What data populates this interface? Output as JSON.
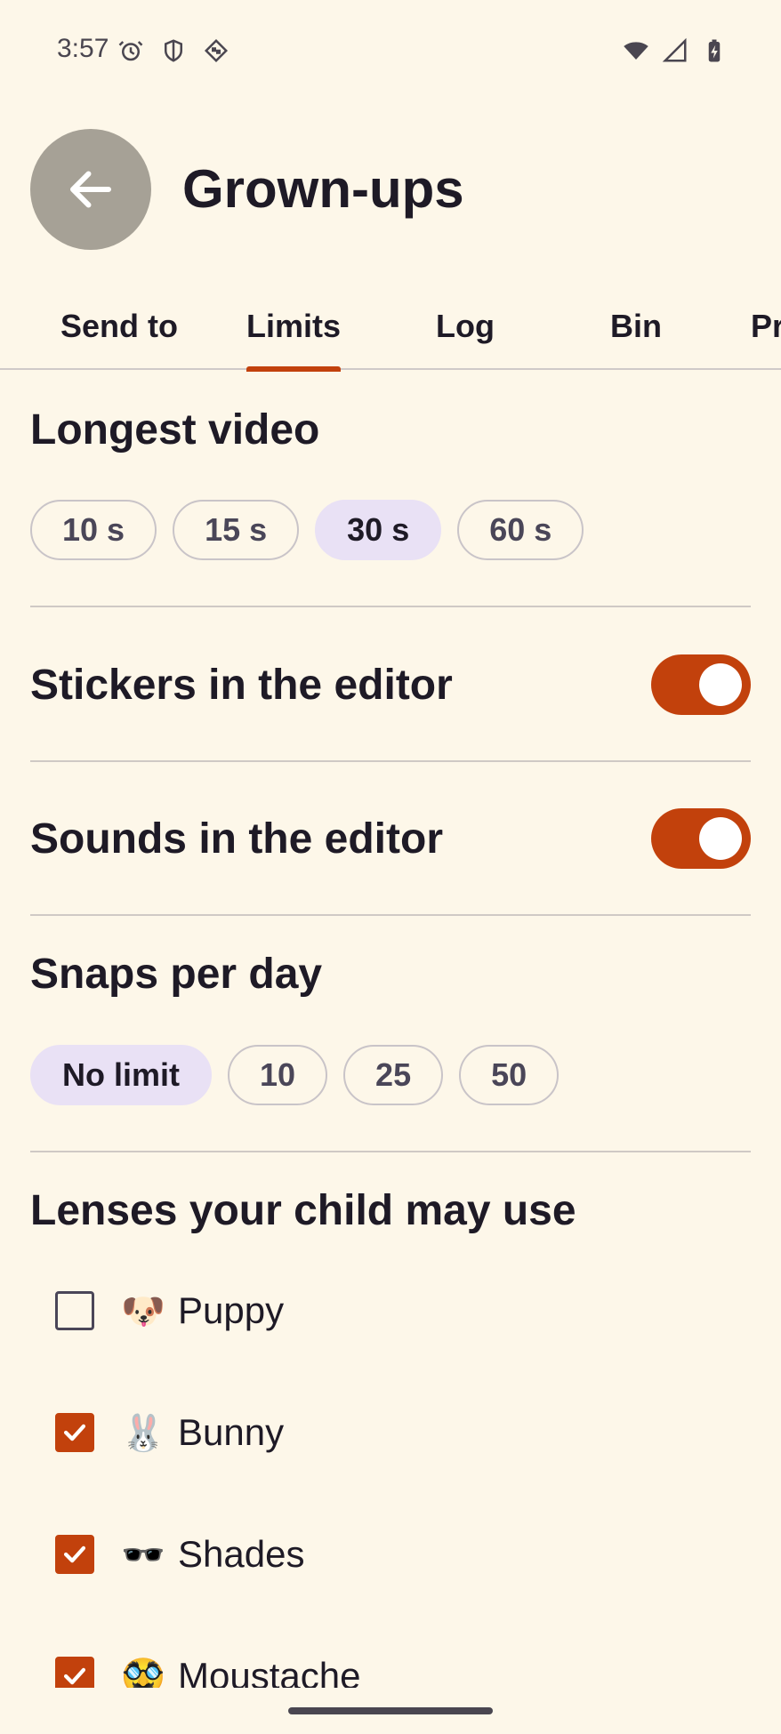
{
  "status_bar": {
    "time": "3:57",
    "left_icons": [
      "alarm-icon",
      "shield-icon",
      "vpn-diamond-icon"
    ],
    "right_icons": [
      "wifi-icon",
      "cell-signal-icon",
      "battery-charging-icon"
    ]
  },
  "header": {
    "back_icon": "arrow-left-icon",
    "title": "Grown-ups"
  },
  "tabs": [
    {
      "label": "Send to",
      "active": false
    },
    {
      "label": "Limits",
      "active": true
    },
    {
      "label": "Log",
      "active": false
    },
    {
      "label": "Bin",
      "active": false
    },
    {
      "label": "Pr",
      "active": false
    }
  ],
  "longest_video": {
    "title": "Longest video",
    "options": [
      {
        "label": "10 s",
        "selected": false
      },
      {
        "label": "15 s",
        "selected": false
      },
      {
        "label": "30 s",
        "selected": true
      },
      {
        "label": "60 s",
        "selected": false
      }
    ]
  },
  "stickers": {
    "label": "Stickers in the editor",
    "on": true
  },
  "sounds": {
    "label": "Sounds in the editor",
    "on": true
  },
  "snaps_per_day": {
    "title": "Snaps per day",
    "options": [
      {
        "label": "No limit",
        "selected": true
      },
      {
        "label": "10",
        "selected": false
      },
      {
        "label": "25",
        "selected": false
      },
      {
        "label": "50",
        "selected": false
      }
    ]
  },
  "lenses": {
    "title": "Lenses your child may use",
    "items": [
      {
        "emoji": "🐶",
        "name": "Puppy",
        "checked": false
      },
      {
        "emoji": "🐰",
        "name": "Bunny",
        "checked": true
      },
      {
        "emoji": "🕶️",
        "name": "Shades",
        "checked": true
      },
      {
        "emoji": "🥸",
        "name": "Moustache",
        "checked": true
      }
    ]
  },
  "colors": {
    "background": "#fdf7e9",
    "accent": "#c2410c",
    "chip_selected": "#e9e1f5",
    "back_button": "#a6a196"
  }
}
